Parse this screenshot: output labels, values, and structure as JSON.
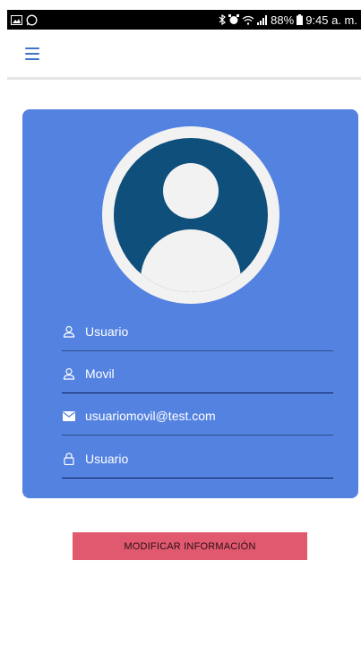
{
  "status_bar": {
    "battery": "88%",
    "time": "9:45 a. m."
  },
  "app_bar": {
    "menu_icon": "hamburger-menu-icon"
  },
  "profile": {
    "avatar_icon": "user-avatar-icon",
    "fields": [
      {
        "icon": "user-outline-icon",
        "value": "Usuario"
      },
      {
        "icon": "user-outline-icon",
        "value": "Movil"
      },
      {
        "icon": "email-icon",
        "value": "usuariomovil@test.com"
      },
      {
        "icon": "lock-icon",
        "value": "Usuario"
      }
    ]
  },
  "actions": {
    "modify_label": "MODIFICAR INFORMACIÓN"
  },
  "colors": {
    "card": "#5482e0",
    "avatar": "#0e4f7b",
    "button": "#e0596f",
    "menu": "#3f73c5"
  }
}
